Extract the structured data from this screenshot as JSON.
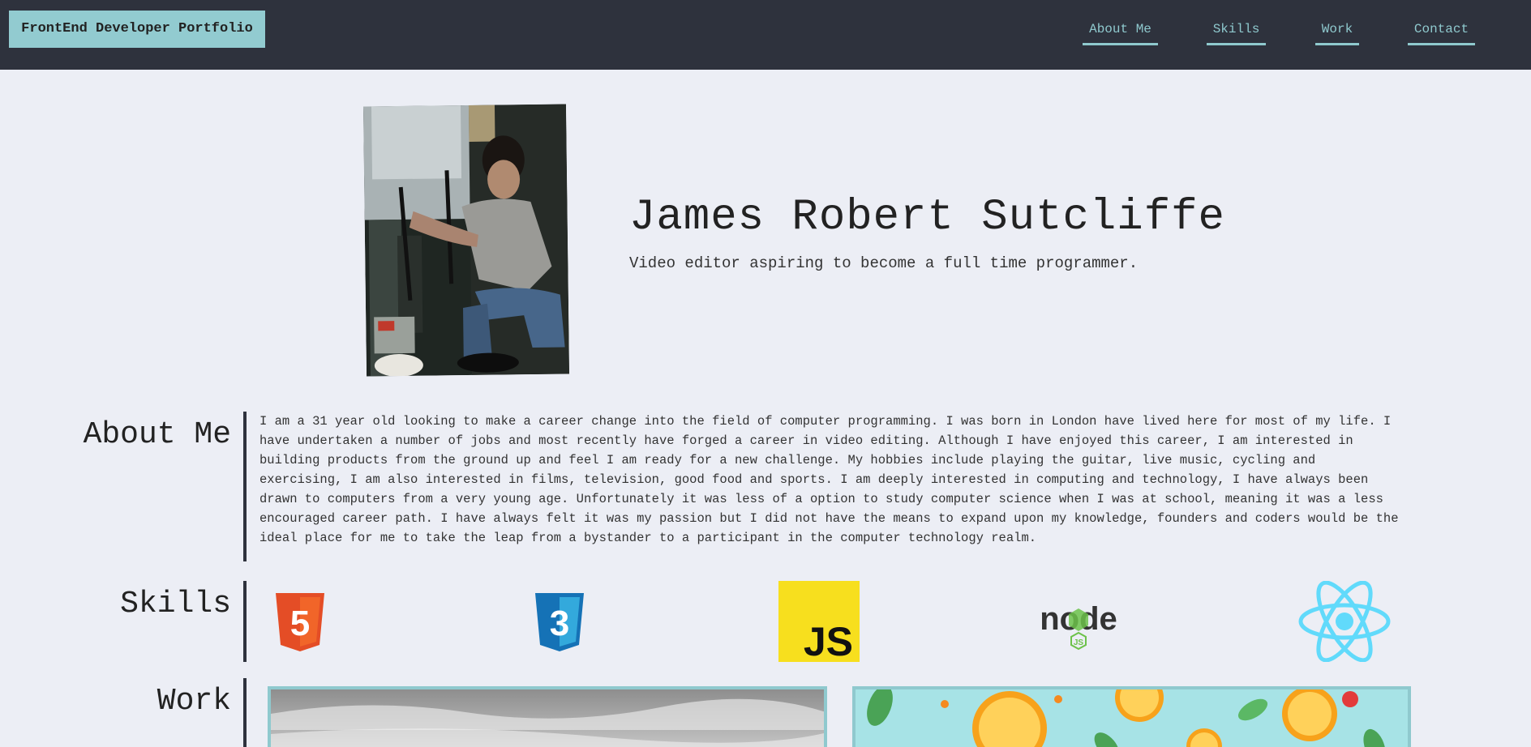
{
  "header": {
    "brand": "FrontEnd Developer Portfolio",
    "nav": [
      "About Me",
      "Skills",
      "Work",
      "Contact"
    ]
  },
  "hero": {
    "name": "James Robert Sutcliffe",
    "tagline": "Video editor aspiring to become a full time programmer."
  },
  "about": {
    "title": "About Me",
    "text": "I am a 31 year old looking to make a career change into the field of computer programming. I was born in London have lived here for most of my life. I have undertaken a number of jobs and most recently have forged a career in video editing. Although I have enjoyed this career, I am interested in building products from the ground up and feel I am ready for a new challenge. My hobbies include playing the guitar, live music, cycling and exercising, I am also interested in films, television, good food and sports. I am deeply interested in computing and technology, I have always been drawn to computers from a very young age. Unfortunately it was less of a option to study computer science when I was at school, meaning it was a less encouraged career path. I have always felt it was my passion but I did not have the means to expand upon my knowledge, founders and coders would be the ideal place for me to take the leap from a bystander to a participant in the computer technology realm."
  },
  "skills": {
    "title": "Skills",
    "items": [
      {
        "icon": "html5-icon",
        "label": "5"
      },
      {
        "icon": "css3-icon",
        "label": "3"
      },
      {
        "icon": "javascript-icon",
        "label": "JS"
      },
      {
        "icon": "nodejs-icon",
        "label": "node",
        "sub": "JS"
      },
      {
        "icon": "react-icon"
      }
    ]
  },
  "work": {
    "title": "Work"
  },
  "colors": {
    "header_bg": "#2e323d",
    "accent": "#8fc9ce",
    "page_bg": "#eceef5"
  }
}
